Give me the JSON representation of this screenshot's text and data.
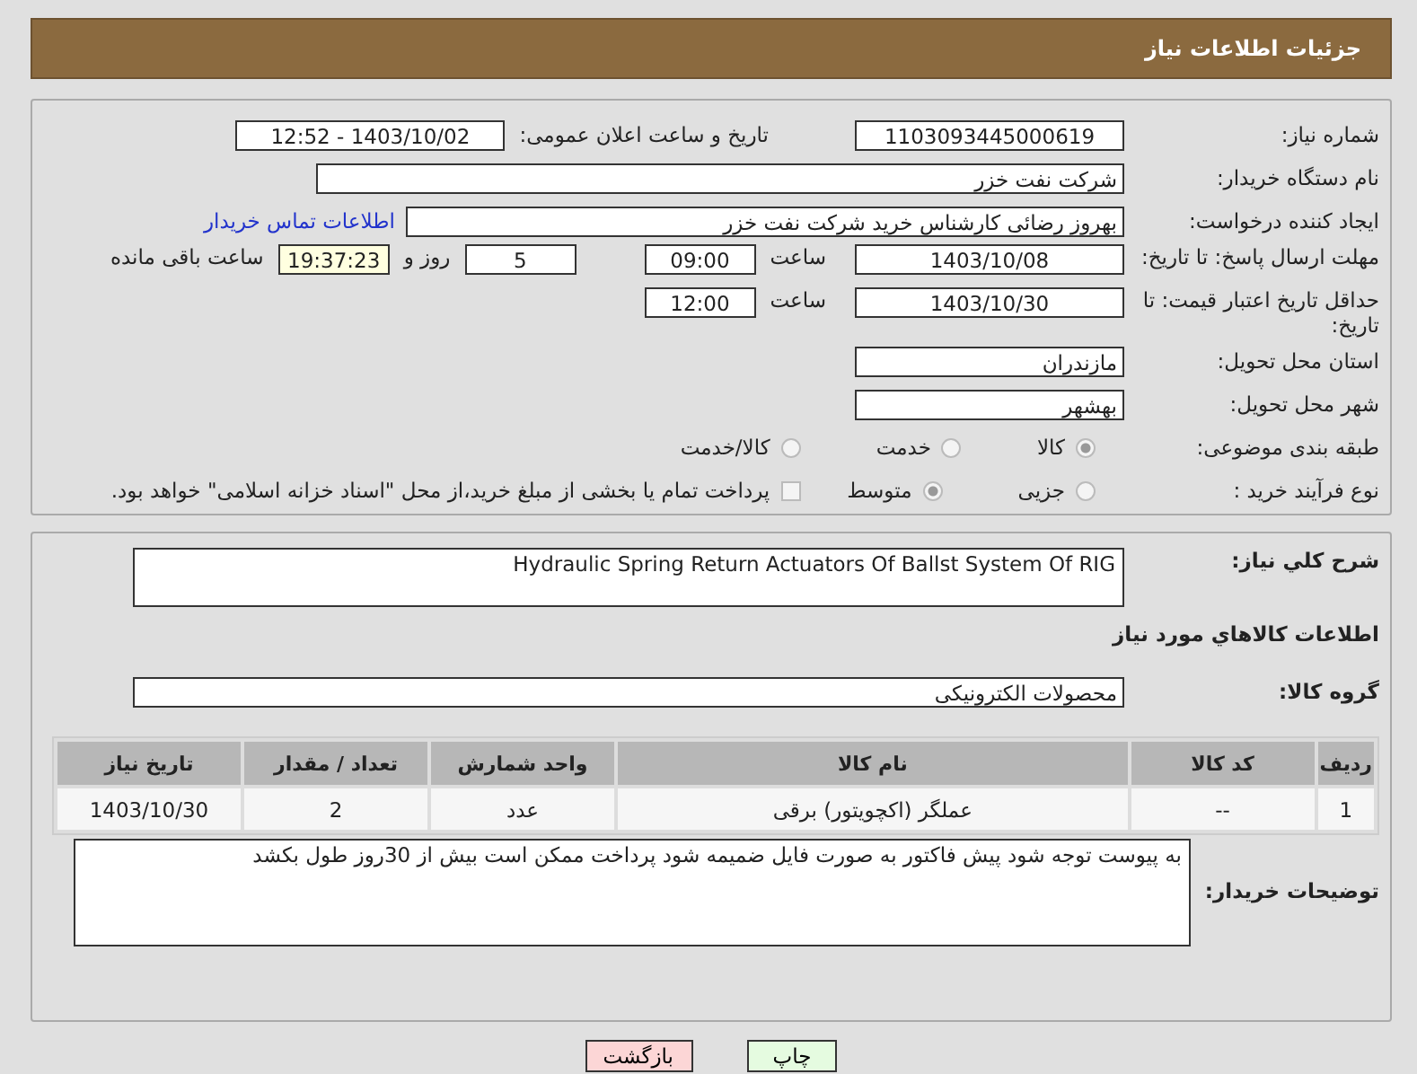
{
  "header": {
    "title": "جزئیات اطلاعات نیاز"
  },
  "need_info": {
    "need_number": {
      "label": "شماره نیاز:",
      "value": "1103093445000619"
    },
    "announce": {
      "label": "تاریخ و ساعت اعلان عمومی:",
      "value": "1403/10/02 - 12:52"
    },
    "buyer_org": {
      "label": "نام دستگاه خریدار:",
      "value": "شرکت نفت خزر"
    },
    "requester": {
      "label": "ایجاد کننده درخواست:",
      "value": "بهروز رضائی کارشناس خرید شرکت نفت خزر",
      "link": "اطلاعات تماس خریدار"
    },
    "reply_deadline": {
      "label": "مهلت ارسال پاسخ: تا تاریخ:",
      "date": "1403/10/08",
      "time_label": "ساعت",
      "time": "09:00",
      "days": "5",
      "days_label": "روز و",
      "remaining": "19:37:23",
      "remaining_label": "ساعت باقی مانده"
    },
    "price_validity": {
      "label": "حداقل تاریخ اعتبار قیمت: تا تاریخ:",
      "date": "1403/10/30",
      "time_label": "ساعت",
      "time": "12:00"
    },
    "province": {
      "label": "استان محل تحویل:",
      "value": "مازندران"
    },
    "city": {
      "label": "شهر محل تحویل:",
      "value": "بهشهر"
    },
    "category": {
      "label": "طبقه بندی موضوعی:",
      "options": [
        {
          "label": "کالا",
          "selected": true
        },
        {
          "label": "خدمت",
          "selected": false
        },
        {
          "label": "کالا/خدمت",
          "selected": false
        }
      ]
    },
    "process": {
      "label": "نوع فرآیند خرید :",
      "options": [
        {
          "label": "جزیی",
          "selected": false
        },
        {
          "label": "متوسط",
          "selected": true
        }
      ],
      "payment": {
        "label": "پرداخت تمام یا بخشی از مبلغ خرید،از محل \"اسناد خزانه اسلامی\" خواهد بود.",
        "checked": false
      }
    }
  },
  "goods": {
    "description": {
      "label": "شرح کلي نياز:",
      "value": "Hydraulic Spring Return Actuators Of Ballst System Of RIG"
    },
    "section_title": "اطلاعات کالاهاي مورد نياز",
    "group": {
      "label": "گروه کالا:",
      "value": "محصولات الکترونیکی"
    },
    "table": {
      "columns": [
        "ردیف",
        "کد کالا",
        "نام کالا",
        "واحد شمارش",
        "تعداد / مقدار",
        "تاریخ نیاز"
      ],
      "rows": [
        [
          "1",
          "--",
          "عملگر (اکچویتور) برقی",
          "عدد",
          "2",
          "1403/10/30"
        ]
      ]
    },
    "notes": {
      "label": "توضیحات خریدار:",
      "value": "به پیوست توجه شود پیش فاکتور به صورت فایل ضمیمه شود پرداخت ممکن است بیش از 30روز طول بکشد"
    }
  },
  "buttons": [
    {
      "label": "چاپ",
      "kind": "print"
    },
    {
      "label": "بازگشت",
      "kind": "back"
    }
  ]
}
